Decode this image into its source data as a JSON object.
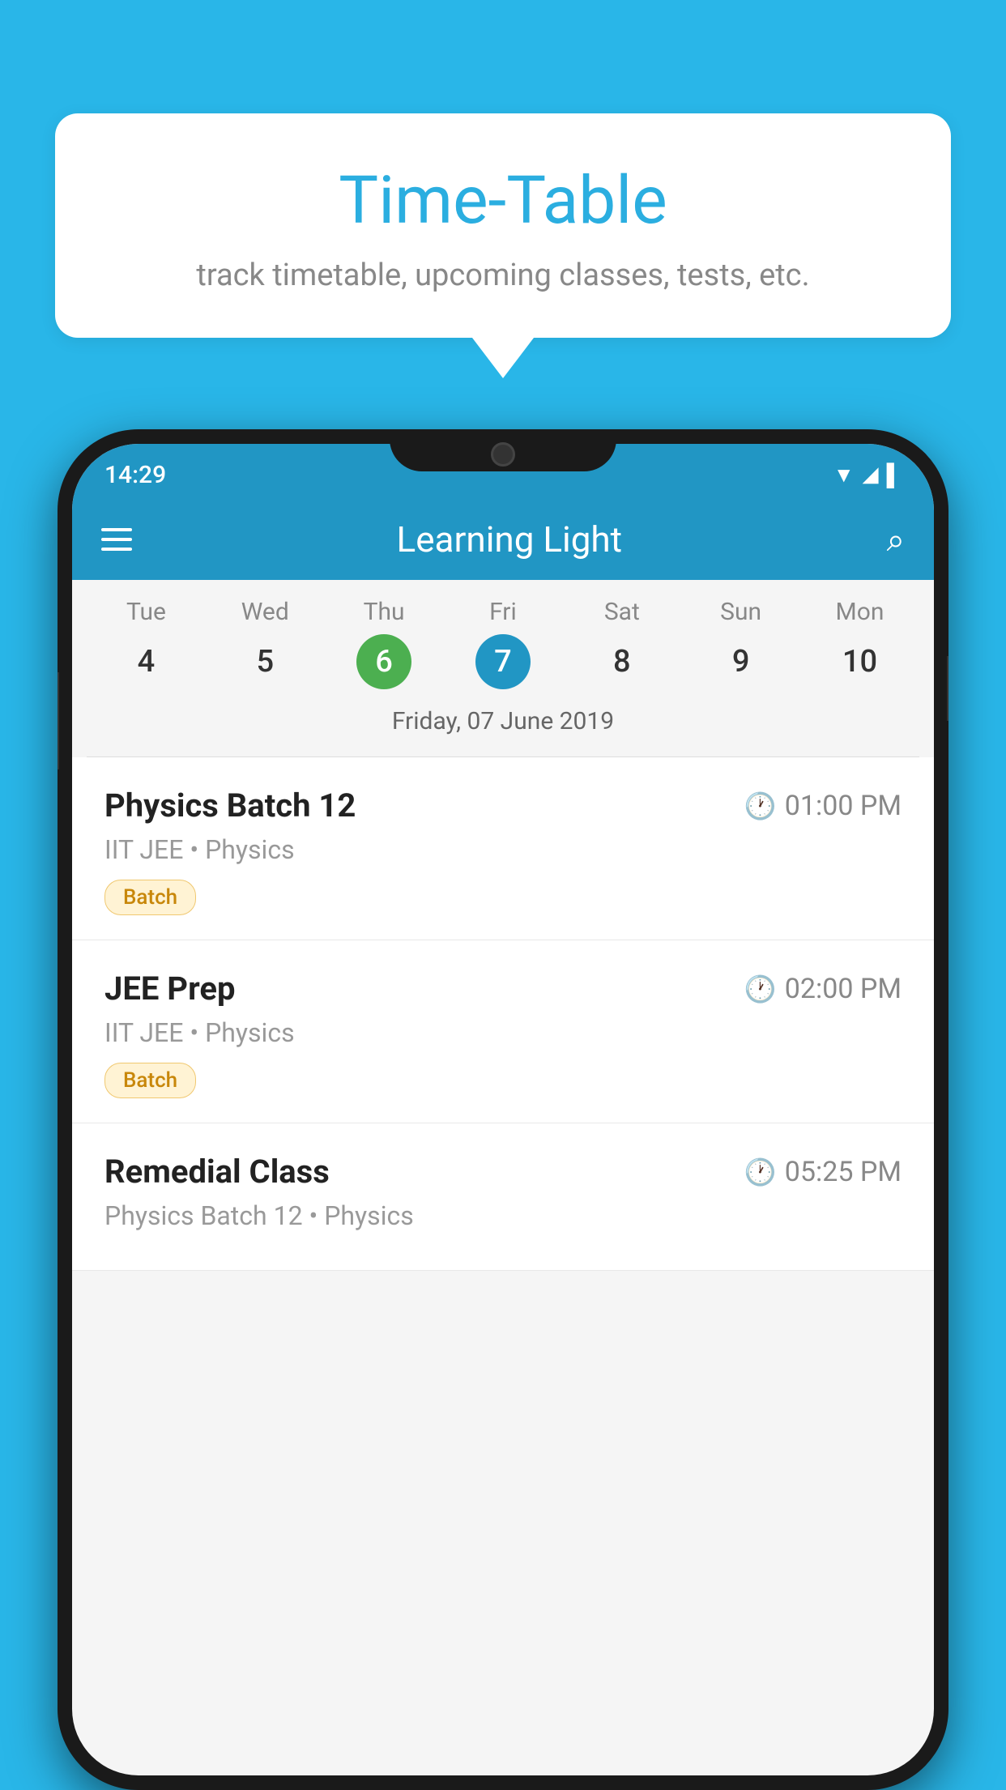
{
  "background": {
    "color": "#29b6e8"
  },
  "speech_bubble": {
    "title": "Time-Table",
    "subtitle": "track timetable, upcoming classes, tests, etc."
  },
  "phone": {
    "status_bar": {
      "time": "14:29"
    },
    "header": {
      "title": "Learning Light"
    },
    "calendar": {
      "days": [
        {
          "label": "Tue",
          "number": "4",
          "state": "normal"
        },
        {
          "label": "Wed",
          "number": "5",
          "state": "normal"
        },
        {
          "label": "Thu",
          "number": "6",
          "state": "today"
        },
        {
          "label": "Fri",
          "number": "7",
          "state": "selected"
        },
        {
          "label": "Sat",
          "number": "8",
          "state": "normal"
        },
        {
          "label": "Sun",
          "number": "9",
          "state": "normal"
        },
        {
          "label": "Mon",
          "number": "10",
          "state": "normal"
        }
      ],
      "selected_date_label": "Friday, 07 June 2019"
    },
    "schedule": [
      {
        "title": "Physics Batch 12",
        "time": "01:00 PM",
        "subtitle": "IIT JEE • Physics",
        "badge": "Batch"
      },
      {
        "title": "JEE Prep",
        "time": "02:00 PM",
        "subtitle": "IIT JEE • Physics",
        "badge": "Batch"
      },
      {
        "title": "Remedial Class",
        "time": "05:25 PM",
        "subtitle": "Physics Batch 12 • Physics",
        "badge": null
      }
    ]
  }
}
